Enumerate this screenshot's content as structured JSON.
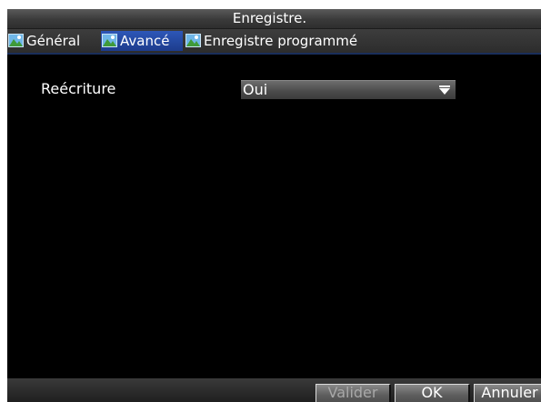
{
  "window": {
    "title": "Enregistre."
  },
  "tabs": [
    {
      "label": "Général",
      "icon": "landscape-icon",
      "active": false
    },
    {
      "label": "Avancé",
      "icon": "landscape-icon",
      "active": true
    },
    {
      "label": "Enregistre programmé",
      "icon": "landscape-icon",
      "active": false
    }
  ],
  "settings": {
    "overwrite_label": "Reécriture",
    "overwrite_value": "Oui"
  },
  "footer": {
    "validate_label": "Valider",
    "ok_label": "OK",
    "cancel_label": "Annuler"
  },
  "colors": {
    "background": "#000000",
    "active_tab": "#2d57b8",
    "chrome": "#3a3a3a"
  }
}
